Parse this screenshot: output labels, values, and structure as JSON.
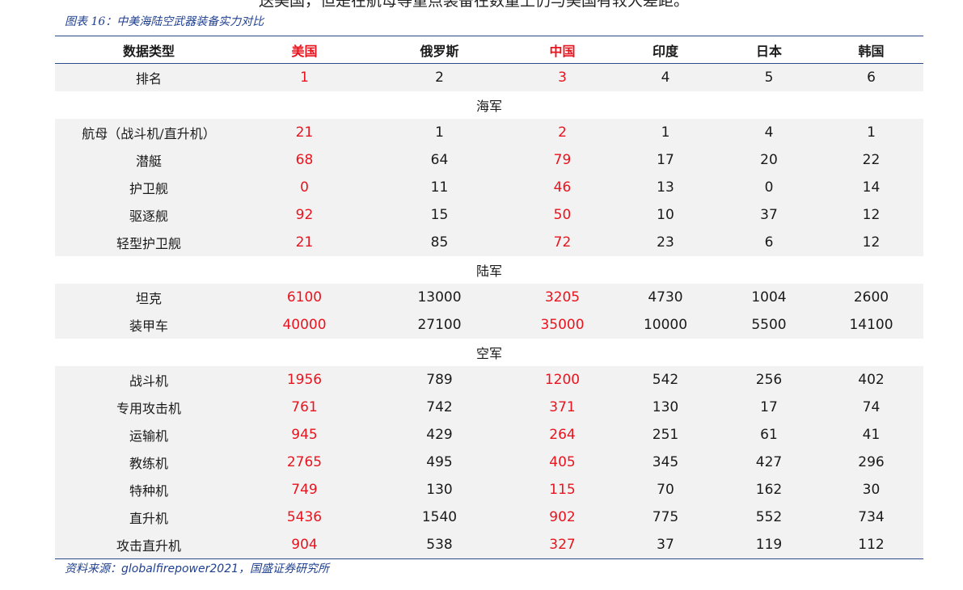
{
  "top_text": "送美国，但是在航母等重点装备在数量上仍与美国有较大差距。",
  "figure_title": "图表 16：中美海陆空武器装备实力对比",
  "headers": [
    "数据类型",
    "美国",
    "俄罗斯",
    "中国",
    "印度",
    "日本",
    "韩国"
  ],
  "rank": {
    "label": "排名",
    "values": [
      "1",
      "2",
      "3",
      "4",
      "5",
      "6"
    ]
  },
  "sections": [
    {
      "name": "海军",
      "rows": [
        {
          "label": "航母（战斗机/直升机）",
          "values": [
            "21",
            "1",
            "2",
            "1",
            "4",
            "1"
          ]
        },
        {
          "label": "潜艇",
          "values": [
            "68",
            "64",
            "79",
            "17",
            "20",
            "22"
          ]
        },
        {
          "label": "护卫舰",
          "values": [
            "0",
            "11",
            "46",
            "13",
            "0",
            "14"
          ]
        },
        {
          "label": "驱逐舰",
          "values": [
            "92",
            "15",
            "50",
            "10",
            "37",
            "12"
          ]
        },
        {
          "label": "轻型护卫舰",
          "values": [
            "21",
            "85",
            "72",
            "23",
            "6",
            "12"
          ]
        }
      ]
    },
    {
      "name": "陆军",
      "rows": [
        {
          "label": "坦克",
          "values": [
            "6100",
            "13000",
            "3205",
            "4730",
            "1004",
            "2600"
          ]
        },
        {
          "label": "装甲车",
          "values": [
            "40000",
            "27100",
            "35000",
            "10000",
            "5500",
            "14100"
          ]
        }
      ]
    },
    {
      "name": "空军",
      "rows": [
        {
          "label": "战斗机",
          "values": [
            "1956",
            "789",
            "1200",
            "542",
            "256",
            "402"
          ]
        },
        {
          "label": "专用攻击机",
          "values": [
            "761",
            "742",
            "371",
            "130",
            "17",
            "74"
          ]
        },
        {
          "label": "运输机",
          "values": [
            "945",
            "429",
            "264",
            "251",
            "61",
            "41"
          ]
        },
        {
          "label": "教练机",
          "values": [
            "2765",
            "495",
            "405",
            "345",
            "427",
            "296"
          ]
        },
        {
          "label": "特种机",
          "values": [
            "749",
            "130",
            "115",
            "70",
            "162",
            "30"
          ]
        },
        {
          "label": "直升机",
          "values": [
            "5436",
            "1540",
            "902",
            "775",
            "552",
            "734"
          ]
        },
        {
          "label": "攻击直升机",
          "values": [
            "904",
            "538",
            "327",
            "37",
            "119",
            "112"
          ]
        }
      ]
    }
  ],
  "source": "资料来源：globalfirepower2021，国盛证券研究所",
  "colors": {
    "highlight": "#e8141e",
    "accent": "#1f3f8f",
    "shade": "#f2f2f2"
  }
}
